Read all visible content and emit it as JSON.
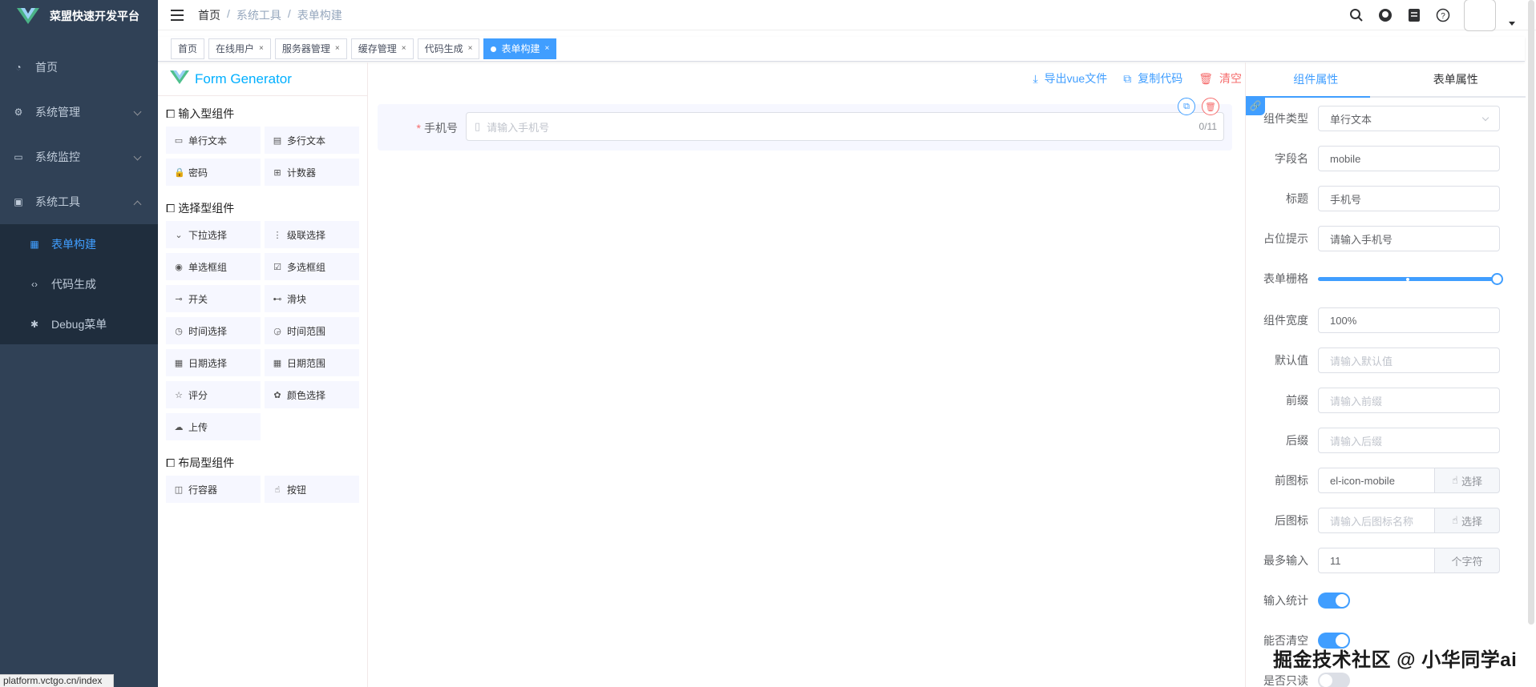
{
  "app": {
    "title": "菜盟快速开发平台"
  },
  "sidebar": {
    "items": [
      {
        "label": "首页",
        "icon": "dashboard-icon"
      },
      {
        "label": "系统管理",
        "icon": "gear-icon"
      },
      {
        "label": "系统监控",
        "icon": "monitor-icon"
      },
      {
        "label": "系统工具",
        "icon": "toolbox-icon"
      }
    ],
    "subitems": [
      {
        "label": "表单构建",
        "icon": "grid-icon",
        "active": true
      },
      {
        "label": "代码生成",
        "icon": "code-icon"
      },
      {
        "label": "Debug菜单",
        "icon": "bug-icon"
      }
    ]
  },
  "status_url": "platform.vctgo.cn/index",
  "breadcrumb": [
    "首页",
    "/",
    "系统工具",
    "/",
    "表单构建"
  ],
  "tags": [
    {
      "label": "首页"
    },
    {
      "label": "在线用户",
      "close": "×"
    },
    {
      "label": "服务器管理",
      "close": "×"
    },
    {
      "label": "缓存管理",
      "close": "×"
    },
    {
      "label": "代码生成",
      "close": "×"
    },
    {
      "label": "表单构建",
      "close": "×",
      "active": true
    }
  ],
  "generator": {
    "title": "Form Generator",
    "groups": [
      {
        "title": "输入型组件",
        "items": [
          {
            "label": "单行文本",
            "icon": "▭"
          },
          {
            "label": "多行文本",
            "icon": "▤"
          },
          {
            "label": "密码",
            "icon": "🔒"
          },
          {
            "label": "计数器",
            "icon": "⊞"
          }
        ]
      },
      {
        "title": "选择型组件",
        "items": [
          {
            "label": "下拉选择",
            "icon": "⌄"
          },
          {
            "label": "级联选择",
            "icon": "⋮"
          },
          {
            "label": "单选框组",
            "icon": "◉"
          },
          {
            "label": "多选框组",
            "icon": "☑"
          },
          {
            "label": "开关",
            "icon": "⊸"
          },
          {
            "label": "滑块",
            "icon": "⊷"
          },
          {
            "label": "时间选择",
            "icon": "◷"
          },
          {
            "label": "时间范围",
            "icon": "◶"
          },
          {
            "label": "日期选择",
            "icon": "▦"
          },
          {
            "label": "日期范围",
            "icon": "▦"
          },
          {
            "label": "评分",
            "icon": "☆"
          },
          {
            "label": "颜色选择",
            "icon": "✿"
          },
          {
            "label": "上传",
            "icon": "☁"
          }
        ]
      },
      {
        "title": "布局型组件",
        "items": [
          {
            "label": "行容器",
            "icon": "◫"
          },
          {
            "label": "按钮",
            "icon": "☝"
          }
        ]
      }
    ]
  },
  "actions": {
    "export": "导出vue文件",
    "copy": "复制代码",
    "clear": "清空"
  },
  "canvas": {
    "field": {
      "required_mark": "*",
      "label": "手机号",
      "placeholder": "请输入手机号",
      "counter": "0/11"
    }
  },
  "props_panel": {
    "tabs": [
      "组件属性",
      "表单属性"
    ],
    "rows": {
      "type": {
        "label": "组件类型",
        "value": "单行文本"
      },
      "field": {
        "label": "字段名",
        "value": "mobile"
      },
      "title": {
        "label": "标题",
        "value": "手机号"
      },
      "placeholder": {
        "label": "占位提示",
        "value": "请输入手机号"
      },
      "grid": {
        "label": "表单栅格",
        "span_fraction": 1.0
      },
      "width": {
        "label": "组件宽度",
        "value": "100%"
      },
      "default": {
        "label": "默认值",
        "placeholder": "请输入默认值"
      },
      "prefix": {
        "label": "前缀",
        "placeholder": "请输入前缀"
      },
      "suffix": {
        "label": "后缀",
        "placeholder": "请输入后缀"
      },
      "prefix_icon": {
        "label": "前图标",
        "value": "el-icon-mobile",
        "button": "选择"
      },
      "suffix_icon": {
        "label": "后图标",
        "placeholder": "请输入后图标名称",
        "button": "选择"
      },
      "maxlength": {
        "label": "最多输入",
        "value": "11",
        "append": "个字符"
      },
      "show_word_limit": {
        "label": "输入统计",
        "on": true
      },
      "clearable": {
        "label": "能否清空",
        "on": true
      },
      "readonly": {
        "label": "是否只读",
        "on": false
      }
    }
  },
  "watermark": "掘金技术社区 @ 小华同学ai",
  "colors": {
    "sidebar_bg": "#304156",
    "submenu_bg": "#1f2d3d",
    "primary": "#409eff",
    "danger": "#f56c6c",
    "brand": "#00afff"
  }
}
